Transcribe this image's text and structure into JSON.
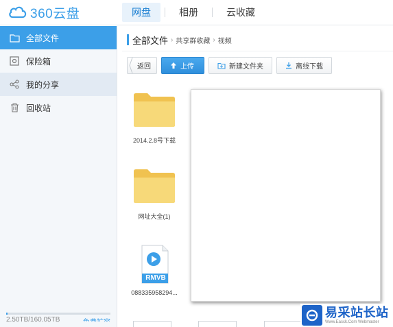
{
  "app": {
    "logo_text": "360云盘"
  },
  "nav": [
    {
      "label": "网盘",
      "active": true
    },
    {
      "label": "相册",
      "active": false
    },
    {
      "label": "云收藏",
      "active": false
    }
  ],
  "sidebar": {
    "items": [
      {
        "label": "全部文件",
        "icon": "folder-icon",
        "state": "active"
      },
      {
        "label": "保险箱",
        "icon": "safe-icon",
        "state": "normal"
      },
      {
        "label": "我的分享",
        "icon": "share-icon",
        "state": "hover"
      },
      {
        "label": "回收站",
        "icon": "trash-icon",
        "state": "normal"
      }
    ],
    "storage": {
      "used": "2.50TB/160.05TB",
      "upgrade": "免费扩容",
      "fraction": 0.016
    }
  },
  "breadcrumb": {
    "root": "全部文件",
    "items": [
      "共享群收藏",
      "视频"
    ]
  },
  "toolbar": {
    "back": "返回",
    "upload": "上传",
    "new_folder": "新建文件夹",
    "offline_download": "离线下载"
  },
  "files": [
    {
      "name": "2014.2.8号下载",
      "type": "folder"
    },
    {
      "name": "网址大全(1)",
      "type": "folder"
    },
    {
      "name": "088335958294...",
      "type": "rmvb",
      "badge": "RMVB"
    }
  ],
  "watermark": {
    "main": "易采站长站",
    "sub": "Www.Easck.Com Webmaster"
  },
  "colors": {
    "accent": "#3c9fe8",
    "folder": "#f7d36e"
  }
}
